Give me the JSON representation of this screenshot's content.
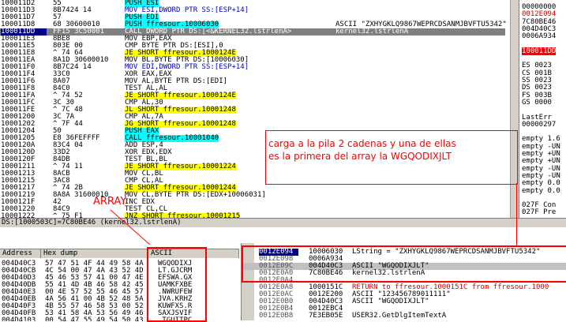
{
  "cpu": {
    "rows": [
      {
        "addr": "100011D2",
        "hex": "55",
        "dis": "PUSH ESI",
        "com": ""
      },
      {
        "addr": "100011D3",
        "hex": "8B7424 14",
        "dis": "MOV ESI,DWORD PTR SS:[ESP+14]",
        "com": ""
      },
      {
        "addr": "100011D7",
        "hex": "57",
        "dis": "PUSH EDI",
        "com": ""
      },
      {
        "addr": "100011D8",
        "hex": "68 30600010",
        "dis": "PUSH ffresour.10006030",
        "com": "ASCII \"ZXHYGKLQ9867WEPRCDSANMJBVFTU5342\""
      },
      {
        "addr": "100011DD",
        "hex": "FF15 3C50001",
        "dis": "CALL DWORD PTR DS:[<&KERNEL32.lstrlenA>",
        "com": "kernel32.lstrlenA"
      },
      {
        "addr": "100011E3",
        "hex": "8BE8",
        "dis": "MOV EBP,EAX",
        "com": ""
      },
      {
        "addr": "100011E5",
        "hex": "803E 00",
        "dis": "CMP BYTE PTR DS:[ESI],0",
        "com": ""
      },
      {
        "addr": "100011E8",
        "hex": "^ 74 64",
        "dis": "JE SHORT ffresour.1000124E",
        "com": ""
      },
      {
        "addr": "100011EA",
        "hex": "8A1D 30600010",
        "dis": "MOV BL,BYTE PTR DS:[10006030]",
        "com": ""
      },
      {
        "addr": "100011F0",
        "hex": "8B7C24 14",
        "dis": "MOV EDI,DWORD PTR SS:[ESP+14]",
        "com": ""
      },
      {
        "addr": "100011F4",
        "hex": "33C0",
        "dis": "XOR EAX,EAX",
        "com": ""
      },
      {
        "addr": "100011F6",
        "hex": "8A07",
        "dis": "MOV AL,BYTE PTR DS:[EDI]",
        "com": ""
      },
      {
        "addr": "100011F8",
        "hex": "84C0",
        "dis": "TEST AL,AL",
        "com": ""
      },
      {
        "addr": "100011FA",
        "hex": "^ 74 52",
        "dis": "JE SHORT ffresour.1000124E",
        "com": ""
      },
      {
        "addr": "100011FC",
        "hex": "3C 30",
        "dis": "CMP AL,30",
        "com": ""
      },
      {
        "addr": "100011FE",
        "hex": "^ 7C 48",
        "dis": "JL SHORT ffresour.10001248",
        "com": ""
      },
      {
        "addr": "10001200",
        "hex": "3C 7A",
        "dis": "CMP AL,7A",
        "com": ""
      },
      {
        "addr": "10001202",
        "hex": "^ 7F 44",
        "dis": "JG SHORT ffresour.10001248",
        "com": ""
      },
      {
        "addr": "10001204",
        "hex": "50",
        "dis": "PUSH EAX",
        "com": ""
      },
      {
        "addr": "10001205",
        "hex": "E8 36FEFFFF",
        "dis": "CALL ffresour.10001040",
        "com": ""
      },
      {
        "addr": "1000120A",
        "hex": "83C4 04",
        "dis": "ADD ESP,4",
        "com": ""
      },
      {
        "addr": "1000120D",
        "hex": "33D2",
        "dis": "XOR EDX,EDX",
        "com": ""
      },
      {
        "addr": "1000120F",
        "hex": "84DB",
        "dis": "TEST BL,BL",
        "com": ""
      },
      {
        "addr": "10001211",
        "hex": "^ 74 11",
        "dis": "JE SHORT ffresour.10001224",
        "com": ""
      },
      {
        "addr": "10001213",
        "hex": "8ACB",
        "dis": "MOV CL,BL",
        "com": ""
      },
      {
        "addr": "10001215",
        "hex": "3AC8",
        "dis": "CMP CL,AL",
        "com": ""
      },
      {
        "addr": "10001217",
        "hex": "^ 74 2B",
        "dis": "JE SHORT ffresour.10001244",
        "com": ""
      },
      {
        "addr": "10001219",
        "hex": "8A8A 31600010",
        "dis": "MOV CL,BYTE PTR DS:[EDX+10006031]",
        "com": ""
      },
      {
        "addr": "1000121F",
        "hex": "42",
        "dis": "INC EDX",
        "com": ""
      },
      {
        "addr": "10001220",
        "hex": "84C9",
        "dis": "TEST CL,CL",
        "com": ""
      },
      {
        "addr": "10001222",
        "hex": "^ 75 F1",
        "dis": "JNZ SHORT ffresour.10001215",
        "com": ""
      }
    ]
  },
  "registers": {
    "lines": [
      {
        "t": "00000000",
        "c": "blk"
      },
      {
        "t": "0012E094",
        "c": "red"
      },
      {
        "t": "7C80BE46",
        "c": "blk"
      },
      {
        "t": "004D40C3",
        "c": "blk"
      },
      {
        "t": "0006A934",
        "c": "blk"
      },
      {
        "t": "",
        "c": "blk"
      },
      {
        "t": "100011DD",
        "c": "sel"
      },
      {
        "t": "",
        "c": "blk"
      },
      {
        "t": "ES 0023",
        "c": "blk"
      },
      {
        "t": "CS 001B",
        "c": "blk"
      },
      {
        "t": "SS 0023",
        "c": "blk"
      },
      {
        "t": "DS 0023",
        "c": "blk"
      },
      {
        "t": "FS 003B",
        "c": "blk"
      },
      {
        "t": "GS 0000",
        "c": "blk"
      },
      {
        "t": "",
        "c": "blk"
      },
      {
        "t": "LastErr",
        "c": "blk"
      },
      {
        "t": "00000297",
        "c": "blk"
      },
      {
        "t": "",
        "c": "blk"
      },
      {
        "t": "empty 1.6",
        "c": "blk"
      },
      {
        "t": "empty -UN",
        "c": "blk"
      },
      {
        "t": "empty +UN",
        "c": "blk"
      },
      {
        "t": "empty +UN",
        "c": "blk"
      },
      {
        "t": "empty -UN",
        "c": "blk"
      },
      {
        "t": "empty -UN",
        "c": "blk"
      },
      {
        "t": "empty 0.0",
        "c": "blk"
      },
      {
        "t": "empty 0.0",
        "c": "blk"
      },
      {
        "t": "",
        "c": "blk"
      },
      {
        "t": "027F  Con",
        "c": "blk"
      },
      {
        "t": "027F  Pre",
        "c": "blk"
      }
    ]
  },
  "info": "DS:[1000503C]=7C80BE46 (kernel32.lstrlenA)",
  "dump": {
    "headers": {
      "address": "Address",
      "hex": "Hex dump",
      "ascii": "ASCII"
    },
    "rows": [
      {
        "addr": "004D40C3",
        "hex": "57 47 51 4F 44 49 58 4A",
        "asc": "WGQODIXJ"
      },
      {
        "addr": "004D40CB",
        "hex": "4C 54 00 47 4A 43 52 4D",
        "asc": "LT.GJCRM"
      },
      {
        "addr": "004D40D3",
        "hex": "45 46 53 57 41 00 47 4E",
        "asc": "EFSWA.GX"
      },
      {
        "addr": "004D40DB",
        "hex": "55 41 4D 4B 46 58 42 45",
        "asc": "UAMKFXBE"
      },
      {
        "addr": "004D40E3",
        "hex": "00 4E 57 52 55 46 45 57",
        "asc": ".NWRUFEW"
      },
      {
        "addr": "004D40EB",
        "hex": "4A 56 41 00 4B 52 48 5A",
        "asc": "JVA.KRHZ"
      },
      {
        "addr": "004D40F3",
        "hex": "4B 55 57 46 58 53 00 52",
        "asc": "KUWFXS.R"
      },
      {
        "addr": "004D40FB",
        "hex": "53 41 58 4A 53 56 49 46",
        "asc": "SAXJSVIF"
      },
      {
        "addr": "004D4103",
        "hex": "00 54 47 55 49 54 50 43",
        "asc": ".TGUITPC"
      }
    ]
  },
  "stack": {
    "rows": [
      {
        "addr": "0012E094",
        "val": "10006030",
        "com": "LString = \"ZXHYGKLQ9867WEPRCDSANMJBVFTU5342\"",
        "sel": true,
        "red": false
      },
      {
        "addr": "0012E098",
        "val": "0006A934",
        "com": "",
        "sel": false,
        "red": false
      },
      {
        "addr": "0012E09C",
        "val": "004D40C3",
        "com": "ASCII \"WGQODIXJLT\"",
        "sel": false,
        "red": false
      },
      {
        "addr": "0012E0A0",
        "val": "7C80BE46",
        "com": "kernel32.lstrlenA",
        "sel": false,
        "red": false
      },
      {
        "addr": "0012E0A4",
        "val": "",
        "com": "",
        "sel": false,
        "red": false
      },
      {
        "addr": "0012E0A8",
        "val": "1000151C",
        "com": "RETURN to ffresour.1000151C from ffresour.1000",
        "sel": false,
        "red": true
      },
      {
        "addr": "0012E0AC",
        "val": "0012E200",
        "com": "ASCII \"123456789011111\"",
        "sel": false,
        "red": false
      },
      {
        "addr": "0012E0B0",
        "val": "004D40C3",
        "com": "ASCII \"WGQODIXJLT\"",
        "sel": false,
        "red": false
      },
      {
        "addr": "0012E0B4",
        "val": "0012EBC4",
        "com": "",
        "sel": false,
        "red": false
      },
      {
        "addr": "0012E0B8",
        "val": "7E3EB05E",
        "com": "USER32.GetDlgItemTextA",
        "sel": false,
        "red": false
      }
    ]
  },
  "annotations": {
    "note1": "carga a la pila 2 cadenas y una de ellas es la primera del array la WGQODIXJLT",
    "note2": "ARRAY"
  },
  "colors": {
    "annotation": "#ff0000",
    "selection": "#000080",
    "jump": "#ffff00",
    "call": "#00ffff"
  }
}
